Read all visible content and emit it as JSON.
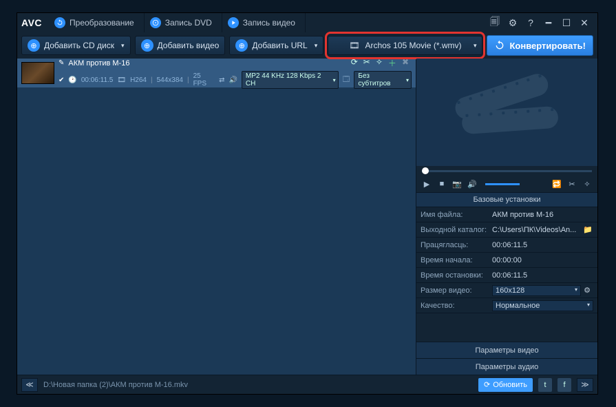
{
  "app": {
    "logo": "AVC"
  },
  "tabs": {
    "convert": "Преобразование",
    "dvd": "Запись DVD",
    "record": "Запись видео"
  },
  "toolbar": {
    "add_cd": "Добавить CD диск",
    "add_video": "Добавить видео",
    "add_url": "Добавить URL",
    "profile": "Archos 105 Movie (*.wmv)",
    "convert": "Конвертировать!"
  },
  "item": {
    "title": "АКМ против М-16",
    "duration": "00:06:11.5",
    "codec": "H264",
    "dims": "544x384",
    "fps": "25 FPS",
    "audio": "MP2 44 KHz 128 Kbps 2 CH",
    "subs": "Без субтитров"
  },
  "settings": {
    "heading": "Базовые установки",
    "file_k": "Имя файла:",
    "file_v": "АКМ против М-16",
    "out_k": "Выходной каталог:",
    "out_v": "C:\\Users\\ПК\\Videos\\An...",
    "dur_k": "Працягласць:",
    "dur_v": "00:06:11.5",
    "start_k": "Время начала:",
    "start_v": "00:00:00",
    "stop_k": "Время остановки:",
    "stop_v": "00:06:11.5",
    "size_k": "Размер видео:",
    "size_v": "160x128",
    "qual_k": "Качество:",
    "qual_v": "Нормальное",
    "params_v": "Параметры видео",
    "params_a": "Параметры аудио"
  },
  "status": {
    "path": "D:\\Новая папка (2)\\АКМ против М-16.mkv",
    "update": "Обновить"
  }
}
